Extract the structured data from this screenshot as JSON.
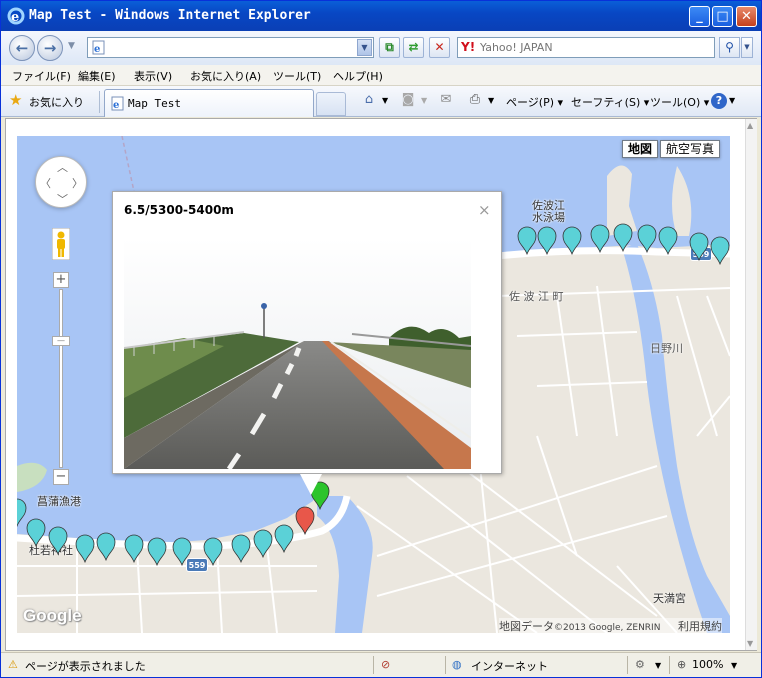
{
  "window": {
    "title": "Map Test - Windows Internet Explorer",
    "min_glyph": "_",
    "max_glyph": "□",
    "close_glyph": "✕"
  },
  "address": {
    "url": "",
    "search_placeholder": "Yahoo! JAPAN"
  },
  "menu": [
    "ファイル(F)",
    "編集(E)",
    "表示(V)",
    "お気に入り(A)",
    "ツール(T)",
    "ヘルプ(H)"
  ],
  "favorites": {
    "label": "お気に入り"
  },
  "tab": {
    "title": "Map Test"
  },
  "commands": {
    "page": "ページ(P)",
    "safety": "セーフティ(S)",
    "tools": "ツール(O)"
  },
  "map": {
    "type_map": "地図",
    "type_satellite": "航空写真",
    "labels": {
      "sabae_pool": "佐波江\n水泳場",
      "sabae_town": "佐 波 江 町",
      "hino_river": "日野川",
      "ayame_port": "菖蒲漁港",
      "morikawa_shrine": "杜若神社",
      "tenman_shrine": "天満宮",
      "route_559": "559"
    },
    "logo": "Google",
    "attribution": "地図データ",
    "attribution_copy": "©2013 Google, ZENRIN",
    "terms": "利用規約"
  },
  "infowindow": {
    "title": "6.5/5300-5400m",
    "close": "×"
  },
  "status": {
    "text": "ページが表示されました",
    "zone": "インターネット",
    "zoom": "100%"
  },
  "colors": {
    "water": "#a8c5f5",
    "marker_cyan": "#5bd1d7",
    "marker_green": "#2cc42c",
    "marker_red": "#e8574a"
  }
}
